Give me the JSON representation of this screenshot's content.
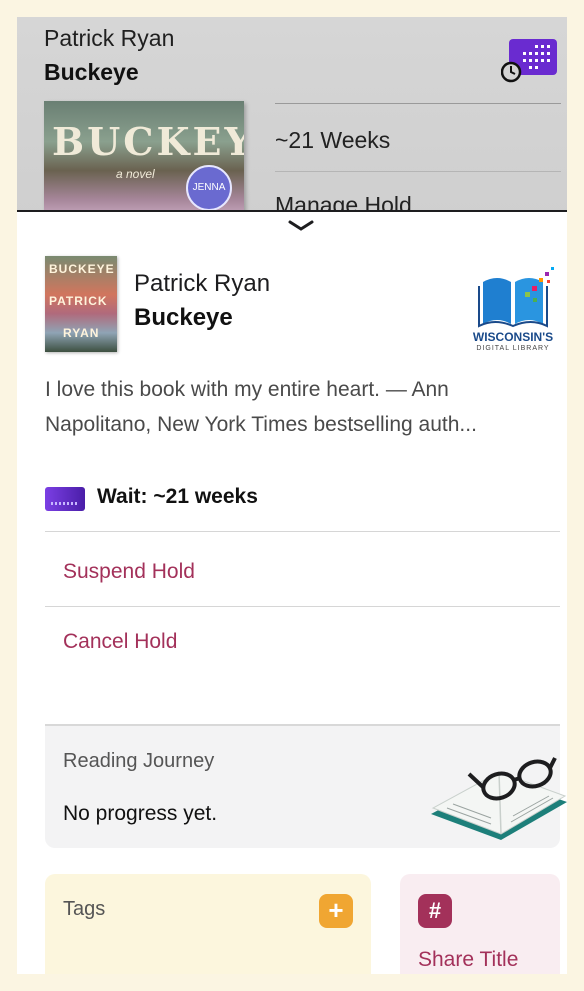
{
  "background_card": {
    "author": "Patrick Ryan",
    "title": "Buckeye",
    "cover_word": "BUCKEYE",
    "cover_sub": "a novel",
    "cover_badge": "JENNA",
    "wait_estimate": "~21 Weeks",
    "manage_label": "Manage Hold"
  },
  "sheet": {
    "cover_lines": [
      "BUCKEYE",
      "PATRICK",
      "RYAN"
    ],
    "author": "Patrick Ryan",
    "title": "Buckeye",
    "library_logo": {
      "name": "WISCONSIN'S",
      "tagline": "DIGITAL LIBRARY"
    },
    "description": "I love this book with my entire heart. — Ann Napolitano, New York Times bestselling auth...",
    "wait_text": "Wait: ~21 weeks",
    "actions": {
      "suspend": "Suspend Hold",
      "cancel": "Cancel Hold"
    },
    "reading_journey": {
      "label": "Reading Journey",
      "value": "No progress yet."
    },
    "tags": {
      "label": "Tags",
      "add_symbol": "+"
    },
    "share": {
      "symbol": "#",
      "label": "Share Title"
    }
  },
  "colors": {
    "accent": "#a3315a",
    "tag_orange": "#f0a632",
    "hold_purple": "#6a2bd0"
  }
}
